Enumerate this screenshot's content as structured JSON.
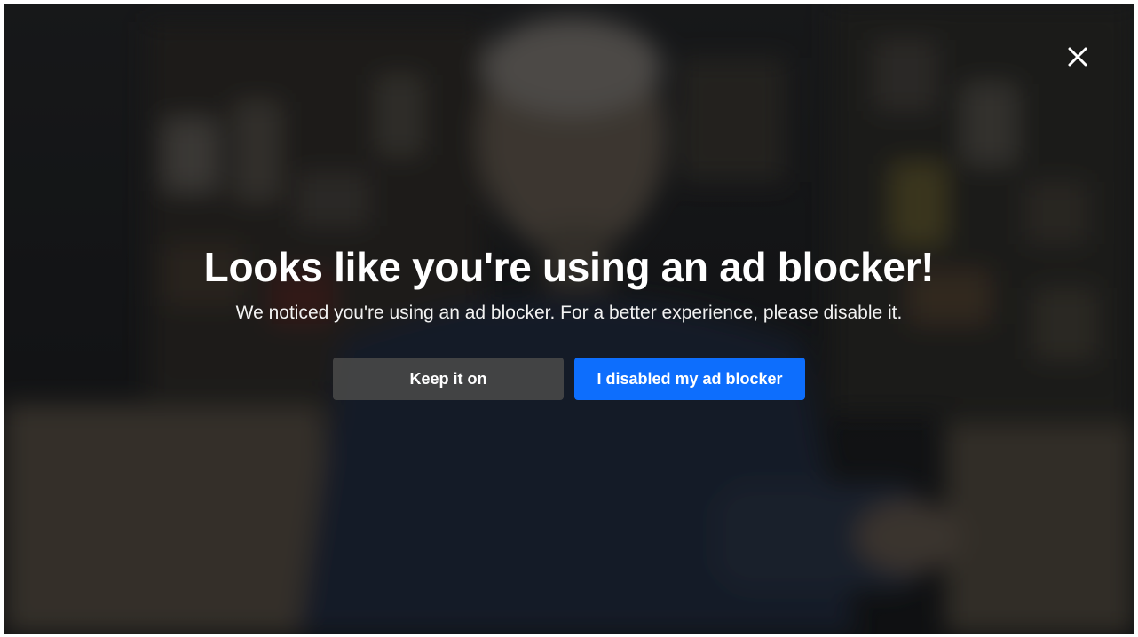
{
  "modal": {
    "title": "Looks like you're using an ad blocker!",
    "message": "We noticed you're using an ad blocker. For a better experience, please disable it.",
    "keep_label": "Keep it on",
    "disabled_label": "I disabled my ad blocker",
    "close_icon": "close-icon"
  },
  "colors": {
    "primary_button": "#0d6efd",
    "secondary_button": "#464646",
    "text": "#ffffff"
  }
}
